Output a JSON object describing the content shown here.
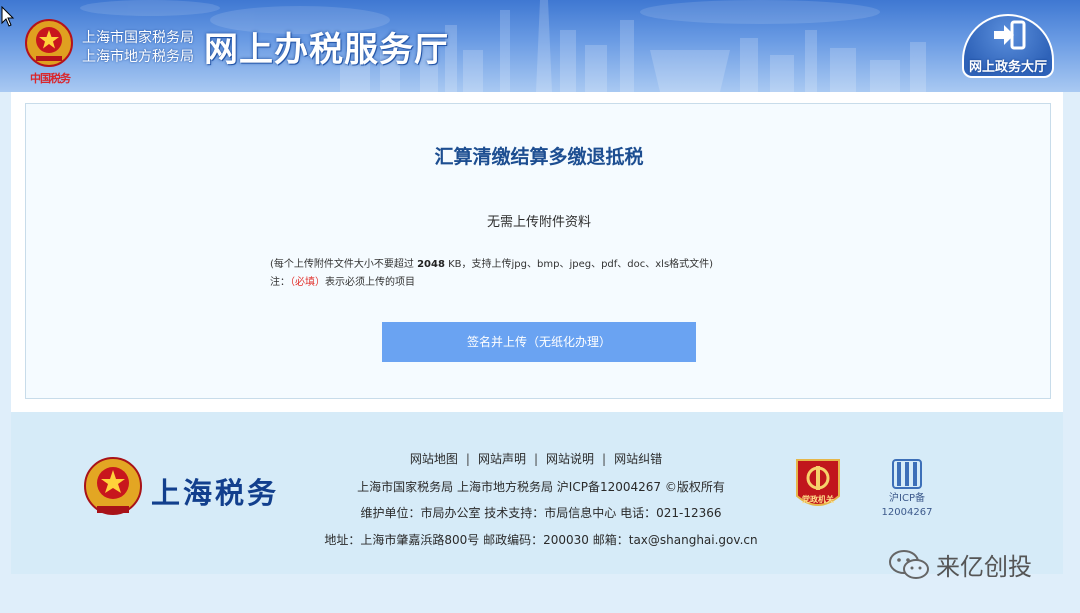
{
  "header": {
    "bureau_national": "上海市国家税务局",
    "bureau_local": "上海市地方税务局",
    "slogan": "中国税务",
    "hall_title": "网上办税服务厅",
    "gov_hall_label": "网上政务大厅"
  },
  "main": {
    "title": "汇算清缴结算多缴退抵税",
    "subtitle": "无需上传附件资料",
    "note_prefix": "(每个上传附件文件大小不要超过 ",
    "note_size": "2048",
    "note_suffix": " KB，支持上传jpg、bmp、jpeg、pdf、doc、xls格式文件)",
    "note2_prefix": "注：",
    "note2_required": "（必填）",
    "note2_suffix": "表示必须上传的项目",
    "sign_button": "签名并上传（无纸化办理）"
  },
  "footer": {
    "brand": "上海税务",
    "links": [
      "网站地图",
      "网站声明",
      "网站说明",
      "网站纠错"
    ],
    "separator": "|",
    "copyright": "上海市国家税务局 上海市地方税务局 沪ICP备12004267 ©版权所有",
    "maintainer": "维护单位：市局办公室 技术支持：市局信息中心 电话：021-12366",
    "address": "地址：上海市肇嘉浜路800号 邮政编码：200030 邮箱：tax@shanghai.gov.cn",
    "party_badge_text": "党政机关",
    "icp_label": "沪ICP备",
    "icp_number": "12004267"
  },
  "watermark": {
    "text": "来亿创投"
  },
  "colors": {
    "header_blue": "#3f78d2",
    "title_blue": "#1d4e91",
    "button_blue": "#6aa3f2",
    "required_red": "#e2312c",
    "footer_bg": "#d6ebf8"
  }
}
